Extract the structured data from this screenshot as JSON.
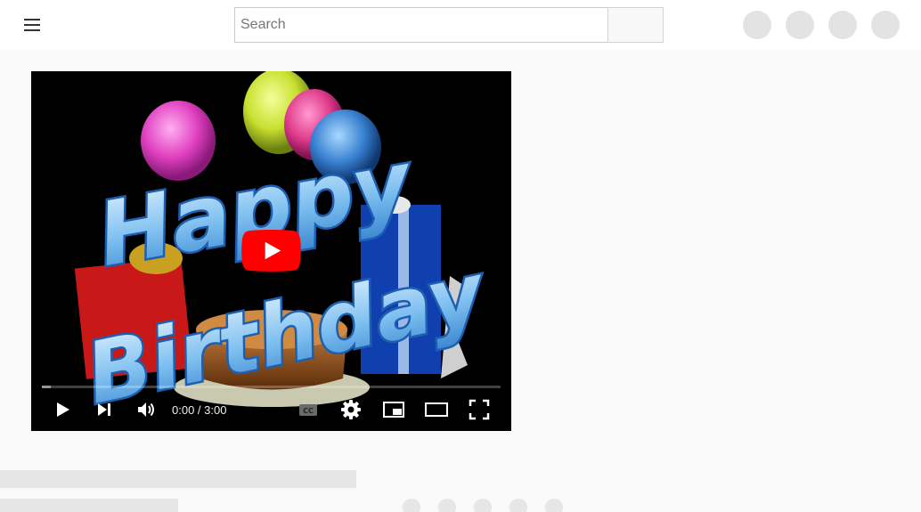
{
  "header": {
    "search_placeholder": "Search",
    "menu_icon": "hamburger-menu-icon",
    "right_icons": [
      "placeholder-circle-icon",
      "placeholder-circle-icon",
      "placeholder-circle-icon",
      "placeholder-circle-icon"
    ]
  },
  "player": {
    "thumbnail_text_line1": "Happy",
    "thumbnail_text_line2": "Birthday",
    "time_display": "0:00 / 3:00",
    "progress_fraction": 0.0,
    "controls": [
      "play-icon",
      "next-icon",
      "volume-icon",
      "captions-icon",
      "settings-gear-icon",
      "miniplayer-icon",
      "theater-mode-icon",
      "fullscreen-icon"
    ],
    "big_play_color": "#ff0000"
  },
  "colors": {
    "background": "#f9f9f9",
    "skeleton": "#e6e6e6"
  }
}
